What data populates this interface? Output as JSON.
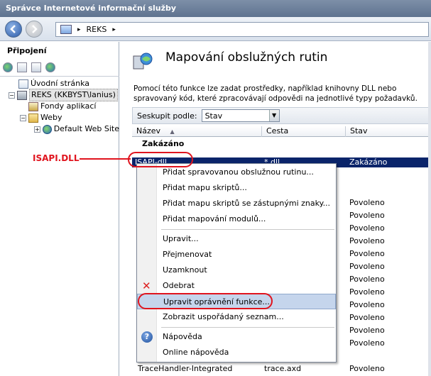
{
  "window": {
    "title": "Správce Internetové informační služby"
  },
  "address": {
    "path": "REKS"
  },
  "connections": {
    "title": "Připojení",
    "tree": [
      {
        "label": "Úvodní stránka",
        "icon": "start-page-icon"
      },
      {
        "label": "REKS (KKBYST\\lanius)",
        "icon": "server-icon"
      },
      {
        "label": "Fondy aplikací",
        "icon": "app-pool-icon"
      },
      {
        "label": "Weby",
        "icon": "folder-icon"
      },
      {
        "label": "Default Web Site",
        "icon": "globe-icon"
      }
    ]
  },
  "main": {
    "title": "Mapování obslužných rutin",
    "description": "Pomocí této funkce lze zadat prostředky, například knihovny DLL nebo spravovaný kód, které zpracovávají odpovědi na jednotlivé typy požadavků.",
    "group_label": "Seskupit podle:",
    "group_value": "Stav",
    "columns": [
      "Název",
      "Cesta",
      "Stav"
    ],
    "group_name": "Zakázáno",
    "selected_row": {
      "name": "ISAPI-dll",
      "path": "*.dll",
      "state": "Zakázáno"
    },
    "rows": [
      {
        "state": "Povoleno"
      },
      {
        "state": "Povoleno"
      },
      {
        "state": "Povoleno"
      },
      {
        "state": "Povoleno"
      },
      {
        "state": "Povoleno"
      },
      {
        "state": "Povoleno"
      },
      {
        "state": "Povoleno"
      },
      {
        "state": "Povoleno"
      },
      {
        "state": "Povoleno"
      },
      {
        "state": "Povoleno"
      },
      {
        "state": "Povoleno"
      },
      {
        "state": "Povoleno"
      }
    ],
    "last_row": {
      "name": "TraceHandler-Integrated",
      "path": "trace.axd",
      "state": "Povoleno"
    }
  },
  "context_menu": {
    "items": [
      "Přidat spravovanou obslužnou rutinu...",
      "Přidat mapu skriptů...",
      "Přidat mapu skriptů se zástupnými znaky...",
      "Přidat mapování modulů...",
      "Upravit...",
      "Přejmenovat",
      "Uzamknout",
      "Odebrat",
      "Upravit oprávnění funkce...",
      "Zobrazit uspořádaný seznam...",
      "Nápověda",
      "Online nápověda"
    ]
  },
  "annotation": {
    "label": "ISAPI.DLL"
  },
  "colors": {
    "accent": "#e0141e",
    "selection": "#0a246a"
  }
}
